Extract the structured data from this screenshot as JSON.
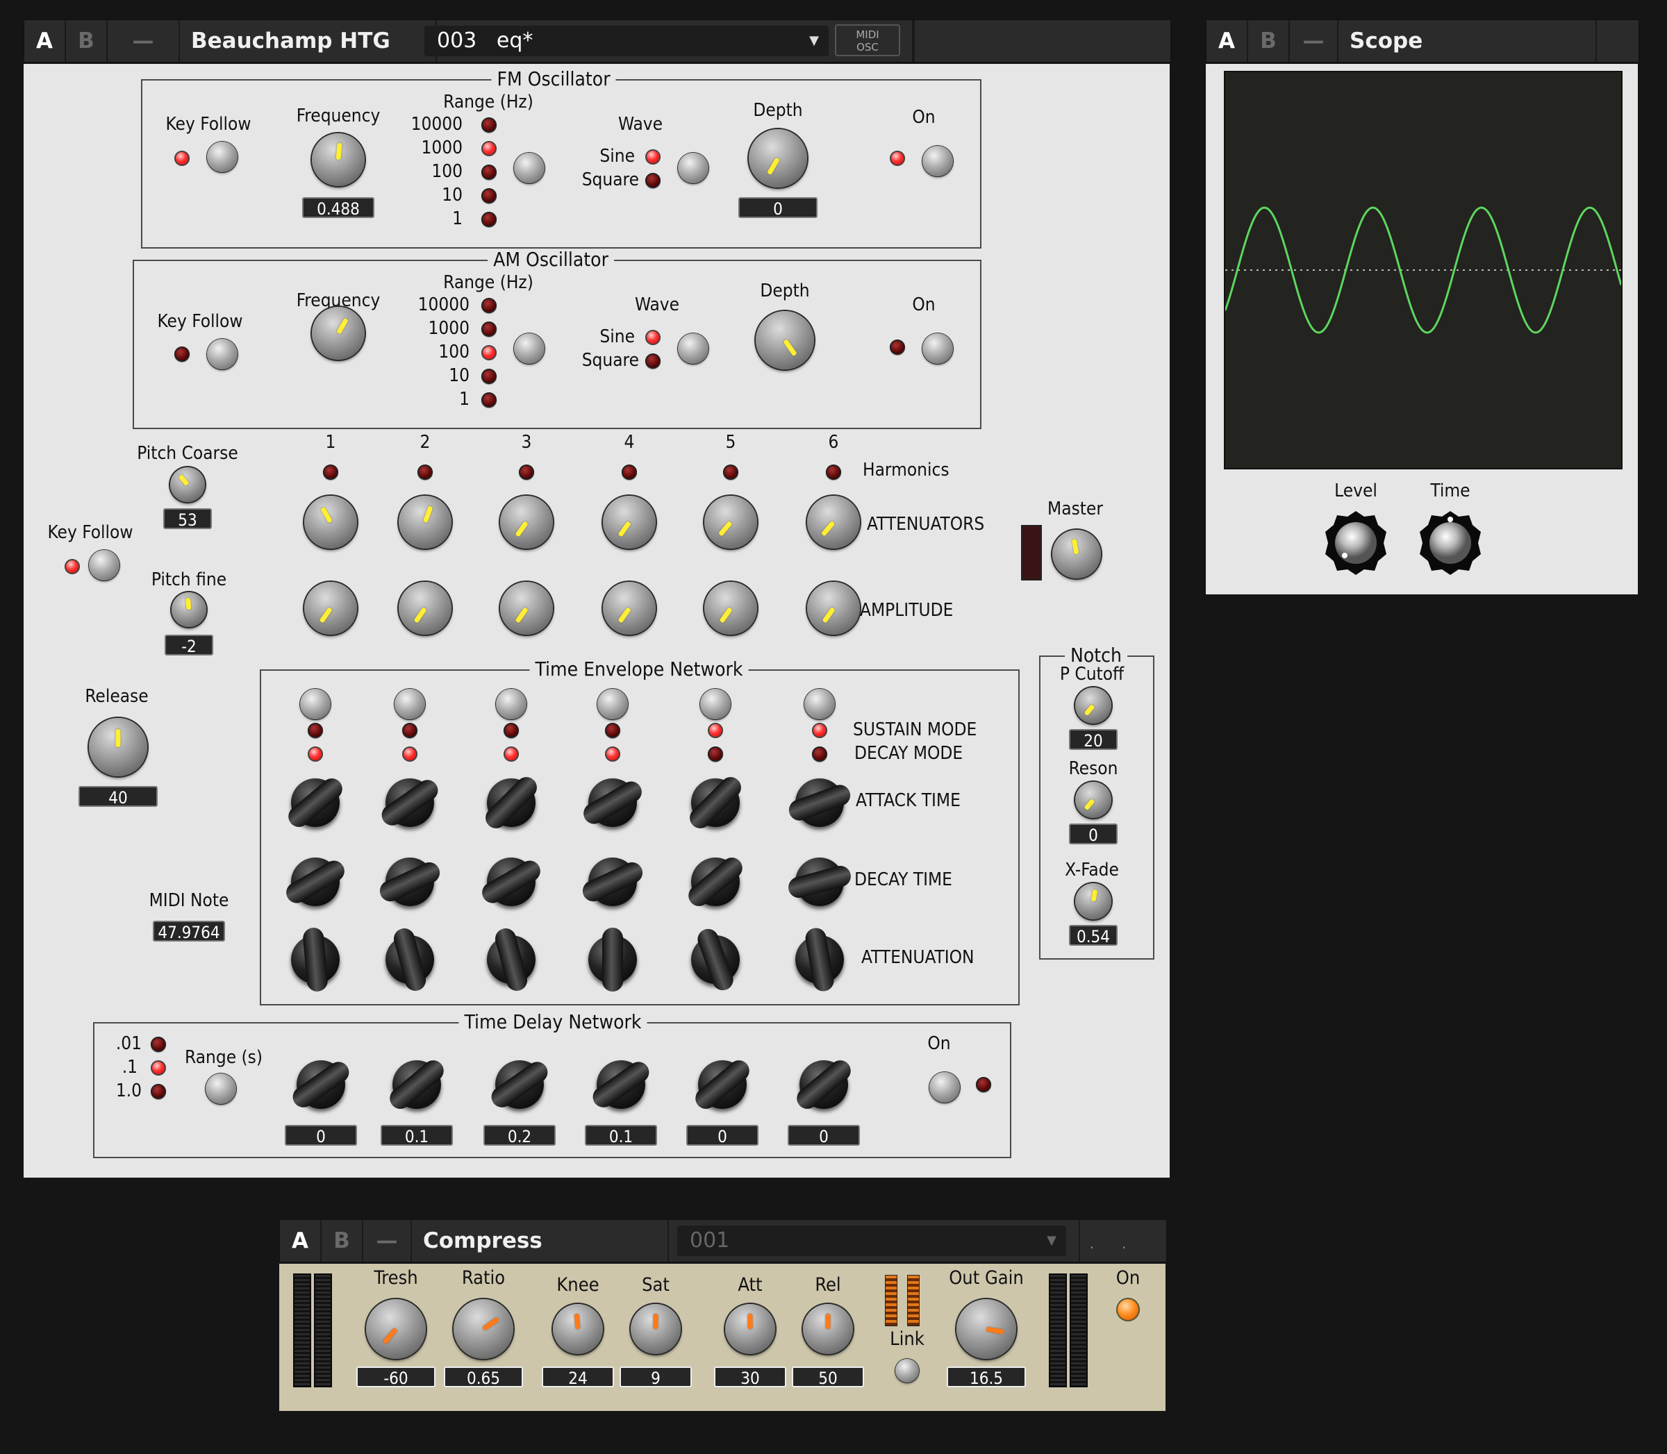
{
  "htg": {
    "header": {
      "slot_a": "A",
      "slot_b": "B",
      "minimize": "—",
      "title": "Beauchamp HTG",
      "preset": "003   eq*",
      "midi_osc": "MIDI\nOSC"
    },
    "fm": {
      "title": "FM Oscillator",
      "key_follow": "Key Follow",
      "frequency": "Frequency",
      "frequency_value": "0.488",
      "range_label": "Range (Hz)",
      "range_values": [
        "10000",
        "1000",
        "100",
        "10",
        "1"
      ],
      "wave": "Wave",
      "sine": "Sine",
      "square": "Square",
      "depth": "Depth",
      "depth_value": "0",
      "on": "On"
    },
    "am": {
      "title": "AM Oscillator",
      "key_follow": "Key Follow",
      "frequency": "Frequency",
      "range_label": "Range (Hz)",
      "range_values": [
        "10000",
        "1000",
        "100",
        "10",
        "1"
      ],
      "wave": "Wave",
      "sine": "Sine",
      "square": "Square",
      "depth": "Depth",
      "on": "On"
    },
    "harmonics": {
      "numbers": [
        "1",
        "2",
        "3",
        "4",
        "5",
        "6"
      ],
      "harmonics_label": "Harmonics",
      "attenuators_label": "ATTENUATORS",
      "amplitude_label": "AMPLITUDE",
      "master_label": "Master"
    },
    "pitch": {
      "coarse_label": "Pitch Coarse",
      "coarse_value": "53",
      "fine_label": "Pitch fine",
      "fine_value": "-2",
      "key_follow": "Key Follow"
    },
    "release": {
      "label": "Release",
      "value": "40"
    },
    "midi_note": {
      "label": "MIDI Note",
      "value": "47.9764"
    },
    "envelope": {
      "title": "Time Envelope Network",
      "sustain_mode": "SUSTAIN MODE",
      "decay_mode": "DECAY MODE",
      "attack_time": "ATTACK TIME",
      "decay_time": "DECAY TIME",
      "attenuation": "ATTENUATION"
    },
    "notch": {
      "title": "Notch",
      "cutoff_label": "P Cutoff",
      "cutoff_value": "20",
      "reson_label": "Reson",
      "reson_value": "0",
      "xfade_label": "X-Fade",
      "xfade_value": "0.54"
    },
    "delay": {
      "title": "Time Delay Network",
      "range_label": "Range (s)",
      "range_values": [
        ".01",
        ".1",
        "1.0"
      ],
      "on": "On",
      "values": [
        "0",
        "0.1",
        "0.2",
        "0.1",
        "0",
        "0"
      ]
    }
  },
  "scope": {
    "header": {
      "slot_a": "A",
      "slot_b": "B",
      "minimize": "—",
      "title": "Scope"
    },
    "level_label": "Level",
    "time_label": "Time",
    "trace_color": "#5ed65e"
  },
  "compress": {
    "header": {
      "slot_a": "A",
      "slot_b": "B",
      "minimize": "—",
      "title": "Compress",
      "preset": "001"
    },
    "tresh_label": "Tresh",
    "tresh_value": "-60",
    "ratio_label": "Ratio",
    "ratio_value": "0.65",
    "knee_label": "Knee",
    "knee_value": "24",
    "sat_label": "Sat",
    "sat_value": "9",
    "att_label": "Att",
    "att_value": "30",
    "rel_label": "Rel",
    "rel_value": "50",
    "link_label": "Link",
    "outgain_label": "Out Gain",
    "outgain_value": "16.5",
    "on_label": "On"
  }
}
